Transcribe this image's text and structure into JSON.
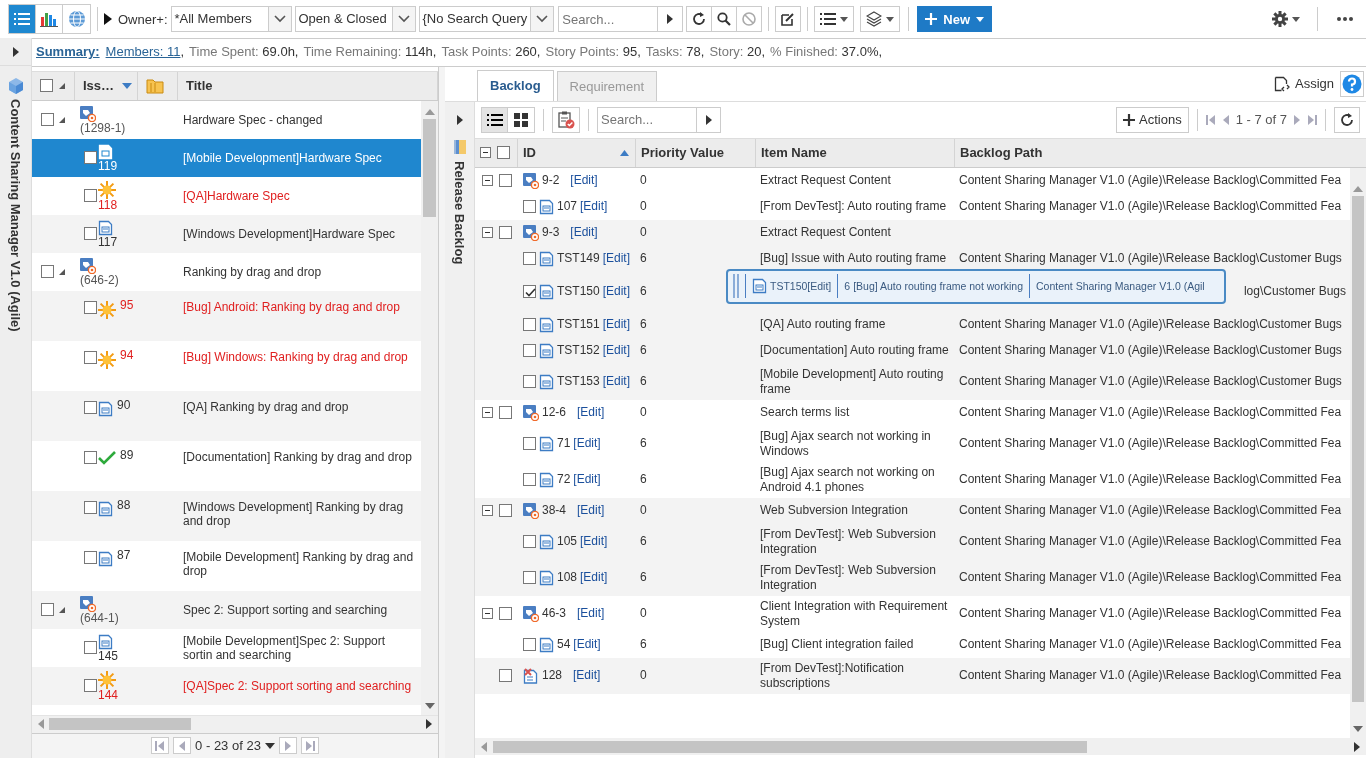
{
  "toolbar": {
    "view_buttons": [
      {
        "kind": "list",
        "selected": true
      },
      {
        "kind": "chart",
        "selected": false
      },
      {
        "kind": "globe",
        "selected": false
      }
    ],
    "owner_label": "Owner+:",
    "dropdowns": [
      {
        "value": "*All Members"
      },
      {
        "value": "Open & Closed"
      },
      {
        "value": "{No Search Query"
      }
    ],
    "search": {
      "placeholder": "Search..."
    },
    "new_button": "New"
  },
  "summary": {
    "label": "Summary:",
    "items": [
      {
        "label": "Members: 11",
        "link": true,
        "suffix": ","
      },
      {
        "label": "Time Spent:",
        "value": "69.0h,"
      },
      {
        "label": "Time Remaining:",
        "value": "114h,"
      },
      {
        "label": "Task Points:",
        "value": "260,"
      },
      {
        "label": "Story Points:",
        "value": "95,"
      },
      {
        "label": "Tasks:",
        "value": "78,"
      },
      {
        "label": "Story:",
        "value": "20,"
      },
      {
        "label": "% Finished:",
        "value": "37.0%,"
      }
    ]
  },
  "sidebar": {
    "title": "Content Sharing Manager V1.0 (Agile)"
  },
  "issues": {
    "select_all": false,
    "columns": [
      "Iss…",
      "Title"
    ],
    "rows": [
      {
        "kind": "group",
        "id": "(1298-1)",
        "title": "Hardware Spec - changed",
        "expanded": true,
        "checked": false,
        "alert": false,
        "selected": false
      },
      {
        "kind": "doc",
        "id": "119",
        "title": "[Mobile Development]Hardware Spec",
        "checked": false,
        "alert": false,
        "selected": true
      },
      {
        "kind": "bug",
        "id": "118",
        "title": "[QA]Hardware Spec",
        "checked": false,
        "alert": true,
        "selected": false
      },
      {
        "kind": "doc",
        "id": "117",
        "title": "[Windows Development]Hardware Spec",
        "checked": false,
        "alert": false,
        "selected": false
      },
      {
        "kind": "group",
        "id": "(646-2)",
        "title": "Ranking by drag and drop",
        "expanded": true,
        "checked": false,
        "alert": false,
        "selected": false
      },
      {
        "kind": "bug-wide",
        "id": "95",
        "title": "[Bug] Android: Ranking by drag and drop",
        "checked": false,
        "alert": true,
        "selected": false
      },
      {
        "kind": "bug-wide",
        "id": "94",
        "title": "[Bug] Windows: Ranking by drag and drop",
        "checked": false,
        "alert": true,
        "selected": false
      },
      {
        "kind": "doc-wide",
        "id": "90",
        "title": "[QA] Ranking by drag and drop",
        "checked": false,
        "alert": false,
        "selected": false
      },
      {
        "kind": "done-wide",
        "id": "89",
        "title": "[Documentation] Ranking by drag and drop",
        "checked": false,
        "alert": false,
        "selected": false
      },
      {
        "kind": "doc-wide",
        "id": "88",
        "title": "[Windows Development] Ranking by drag and drop",
        "checked": false,
        "alert": false,
        "selected": false
      },
      {
        "kind": "doc-wide",
        "id": "87",
        "title": "[Mobile Development] Ranking by drag and drop",
        "checked": false,
        "alert": false,
        "selected": false
      },
      {
        "kind": "group",
        "id": "(644-1)",
        "title": "Spec 2: Support sorting and searching",
        "expanded": true,
        "checked": false,
        "alert": false,
        "selected": false
      },
      {
        "kind": "doc",
        "id": "145",
        "title": "[Mobile Development]Spec 2: Support sortin and searching",
        "checked": false,
        "alert": false,
        "selected": false
      },
      {
        "kind": "bug",
        "id": "144",
        "title": "[QA]Spec 2: Support sorting and searching",
        "checked": false,
        "alert": true,
        "selected": false
      }
    ],
    "pager": "0 - 23 of 23"
  },
  "backlog": {
    "tabs": [
      {
        "label": "Backlog",
        "selected": true
      },
      {
        "label": "Requirement",
        "selected": false
      }
    ],
    "assign": "Assign",
    "side_title": "Release Backlog",
    "view_buttons": [
      {
        "kind": "list",
        "selected": true
      },
      {
        "kind": "grid",
        "selected": false
      }
    ],
    "search": {
      "placeholder": "Search..."
    },
    "actions": "Actions",
    "pager": "1 - 7 of 7",
    "select_all": false,
    "columns": [
      "ID",
      "Priority Value",
      "Item Name",
      "Backlog Path"
    ],
    "rows": [
      {
        "kind": "group",
        "expanded": true,
        "checked": false,
        "id": "9-2",
        "edit": "[Edit]",
        "priority": "0",
        "name": "Extract Request Content",
        "path": "Content Sharing Manager V1.0 (Agile)\\Release Backlog\\Committed Fea"
      },
      {
        "kind": "item",
        "checked": false,
        "id": "107",
        "edit": "[Edit]",
        "priority": "0",
        "name": "[From DevTest]: Auto routing frame",
        "path": "Content Sharing Manager V1.0 (Agile)\\Release Backlog\\Committed Fea"
      },
      {
        "kind": "group",
        "expanded": true,
        "checked": false,
        "id": "9-3",
        "edit": "[Edit]",
        "priority": "0",
        "name": "Extract Request Content"
      },
      {
        "kind": "item",
        "checked": false,
        "id": "TST149",
        "edit": "[Edit]",
        "priority": "6",
        "name": "[Bug] Issue with Auto routing frame",
        "path": "Content Sharing Manager V1.0 (Agile)\\Release Backlog\\Customer Bugs"
      },
      {
        "kind": "item",
        "checked": true,
        "covered": true,
        "id": "TST150",
        "edit": "[Edit]",
        "priority": "6",
        "path": "log\\Customer Bugs"
      },
      {
        "kind": "item",
        "checked": false,
        "id": "TST151",
        "edit": "[Edit]",
        "priority": "6",
        "name": "[QA] Auto routing frame",
        "path": "Content Sharing Manager V1.0 (Agile)\\Release Backlog\\Customer Bugs"
      },
      {
        "kind": "item",
        "checked": false,
        "id": "TST152",
        "edit": "[Edit]",
        "priority": "6",
        "name": "[Documentation] Auto routing frame",
        "path": "Content Sharing Manager V1.0 (Agile)\\Release Backlog\\Customer Bugs"
      },
      {
        "kind": "item",
        "checked": false,
        "id": "TST153",
        "edit": "[Edit]",
        "priority": "6",
        "name": "[Mobile Development] Auto routing frame",
        "path": "Content Sharing Manager V1.0 (Agile)\\Release Backlog\\Customer Bugs"
      },
      {
        "kind": "group",
        "expanded": true,
        "checked": false,
        "id": "12-6",
        "edit": "[Edit]",
        "priority": "0",
        "name": "Search terms list",
        "path": "Content Sharing Manager V1.0 (Agile)\\Release Backlog\\Committed Fea"
      },
      {
        "kind": "item",
        "checked": false,
        "id": "71",
        "edit": "[Edit]",
        "priority": "6",
        "name": "[Bug] Ajax search not working in Windows",
        "path": "Content Sharing Manager V1.0 (Agile)\\Release Backlog\\Committed Fea"
      },
      {
        "kind": "item",
        "checked": false,
        "id": "72",
        "edit": "[Edit]",
        "priority": "6",
        "name": "[Bug] Ajax search not working on Android 4.1 phones",
        "path": "Content Sharing Manager V1.0 (Agile)\\Release Backlog\\Committed Fea"
      },
      {
        "kind": "group",
        "expanded": true,
        "checked": false,
        "id": "38-4",
        "edit": "[Edit]",
        "priority": "0",
        "name": "Web Subversion Integration",
        "path": "Content Sharing Manager V1.0 (Agile)\\Release Backlog\\Committed Fea"
      },
      {
        "kind": "item",
        "checked": false,
        "id": "105",
        "edit": "[Edit]",
        "priority": "6",
        "name": "[From DevTest]: Web Subversion Integration",
        "path": "Content Sharing Manager V1.0 (Agile)\\Release Backlog\\Committed Fea"
      },
      {
        "kind": "item",
        "checked": false,
        "id": "108",
        "edit": "[Edit]",
        "priority": "6",
        "name": "[From DevTest]: Web Subversion Integration",
        "path": "Content Sharing Manager V1.0 (Agile)\\Release Backlog\\Committed Fea"
      },
      {
        "kind": "group",
        "expanded": true,
        "checked": false,
        "id": "46-3",
        "edit": "[Edit]",
        "priority": "0",
        "name": "Client Integration with Requirement System",
        "path": "Content Sharing Manager V1.0 (Agile)\\Release Backlog\\Committed Fea"
      },
      {
        "kind": "item",
        "checked": false,
        "id": "54",
        "edit": "[Edit]",
        "priority": "6",
        "name": "[Bug] Client integration failed",
        "path": "Content Sharing Manager V1.0 (Agile)\\Release Backlog\\Committed Fea"
      },
      {
        "kind": "feature",
        "checked": false,
        "id": "128",
        "edit": "[Edit]",
        "priority": "0",
        "name": "[From DevTest]:Notification subscriptions",
        "path": "Content Sharing Manager V1.0 (Agile)\\Release Backlog\\Committed Fea"
      }
    ],
    "drag_ghost": {
      "id": "TST150",
      "edit": "[Edit]",
      "priority": "6",
      "name": "[Bug] Auto routing frame not working",
      "path": "Content Sharing Manager V1.0 (Agil"
    }
  }
}
